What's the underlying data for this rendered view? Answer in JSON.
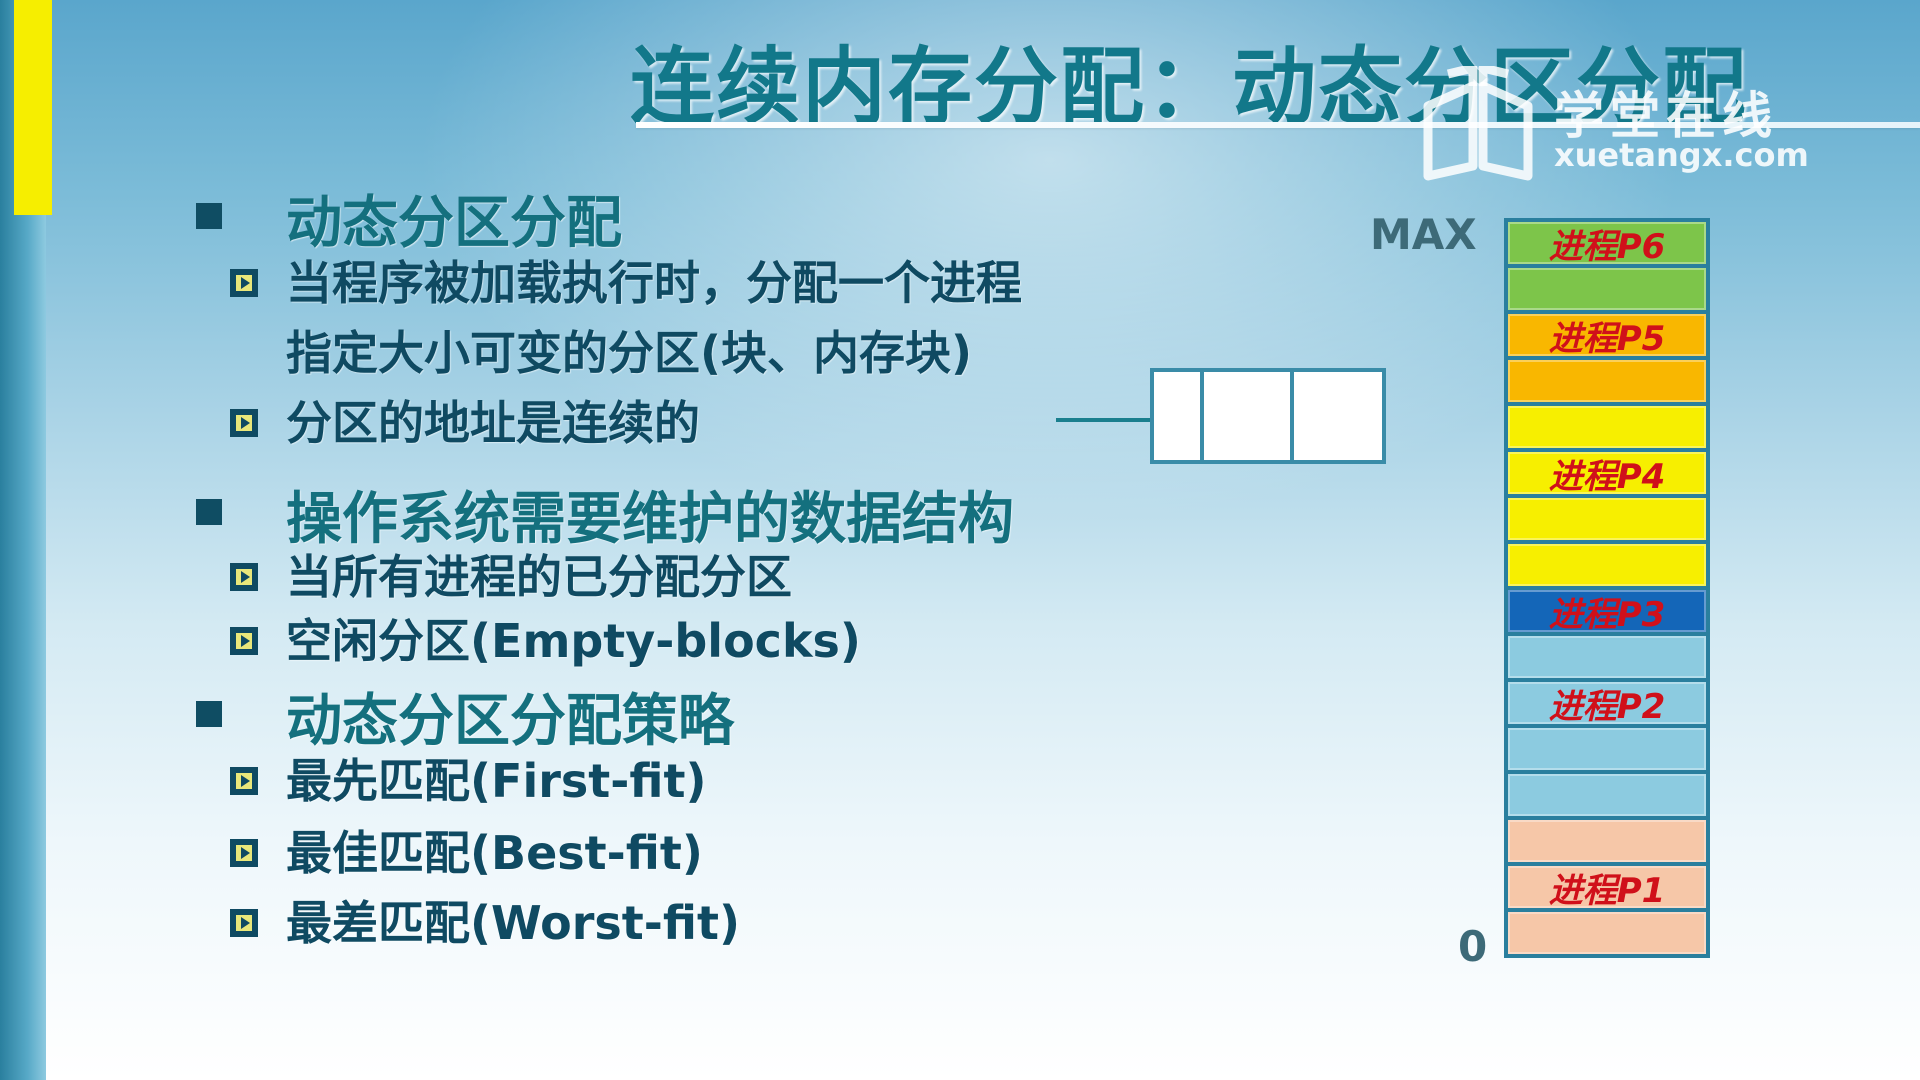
{
  "slide": {
    "title": "连续内存分配：动态分区分配",
    "watermark": {
      "cn": "学堂在线",
      "en": "xuetangx.com"
    }
  },
  "bullets": [
    {
      "level": 1,
      "text": "动态分区分配"
    },
    {
      "level": 2,
      "text": "当程序被加载执行时，分配一个进程"
    },
    {
      "level": 2,
      "text": "指定大小可变的分区(块、内存块)",
      "continuation": true
    },
    {
      "level": 2,
      "text": "分区的地址是连续的"
    },
    {
      "level": 1,
      "text": "操作系统需要维护的数据结构"
    },
    {
      "level": 2,
      "text": "当所有进程的已分配分区"
    },
    {
      "level": 2,
      "text": "空闲分区(Empty-blocks)"
    },
    {
      "level": 1,
      "text": "动态分区分配策略"
    },
    {
      "level": 2,
      "text": "最先匹配(First-fit)"
    },
    {
      "level": 2,
      "text": "最佳匹配(Best-fit)"
    },
    {
      "level": 2,
      "text": "最差匹配(Worst-fit)"
    }
  ],
  "memory": {
    "top_label": "MAX",
    "bottom_label": "0",
    "cells_top_to_bottom": [
      {
        "label": "进程P6",
        "color": "#7dc54a"
      },
      {
        "label": "",
        "color": "#7dc54a"
      },
      {
        "label": "进程P5",
        "color": "#f9b700"
      },
      {
        "label": "",
        "color": "#f9b700"
      },
      {
        "label": "",
        "color": "#f7ef00"
      },
      {
        "label": "进程P4",
        "color": "#f7ef00"
      },
      {
        "label": "",
        "color": "#f7ef00"
      },
      {
        "label": "",
        "color": "#f7ef00"
      },
      {
        "label": "进程P3",
        "color": "#1466b8"
      },
      {
        "label": "",
        "color": "#8ccbe0"
      },
      {
        "label": "进程P2",
        "color": "#8ccbe0"
      },
      {
        "label": "",
        "color": "#8ccbe0"
      },
      {
        "label": "",
        "color": "#8ccbe0"
      },
      {
        "label": "",
        "color": "#f6c7a8"
      },
      {
        "label": "进程P1",
        "color": "#f6c7a8"
      },
      {
        "label": "",
        "color": "#f6c7a8"
      }
    ]
  },
  "free_list": {
    "block_count": 3
  }
}
